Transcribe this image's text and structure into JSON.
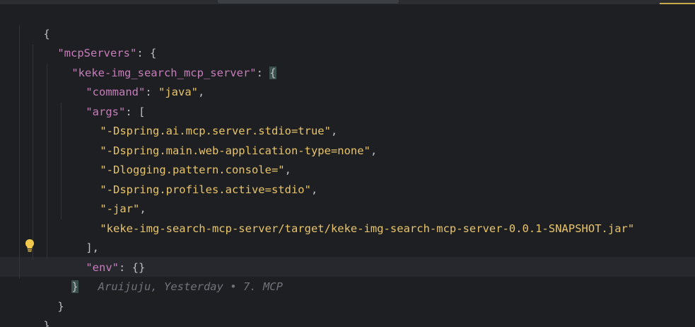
{
  "editor": {
    "language": "json",
    "lines": [
      {
        "id": "l1",
        "tokens": [
          "{"
        ]
      },
      {
        "id": "l2",
        "tokens": [
          "\"mcpServers\"",
          ": {"
        ]
      },
      {
        "id": "l3",
        "tokens": [
          "\"keke-img_search_mcp_server\"",
          ": ",
          "{"
        ]
      },
      {
        "id": "l4",
        "tokens": [
          "\"command\"",
          ": ",
          "\"java\"",
          ","
        ]
      },
      {
        "id": "l5",
        "tokens": [
          "\"args\"",
          ": ["
        ]
      },
      {
        "id": "l6",
        "tokens": [
          "\"-Dspring.ai.mcp.server.stdio=true\"",
          ","
        ]
      },
      {
        "id": "l7",
        "tokens": [
          "\"-Dspring.main.web-application-type=none\"",
          ","
        ]
      },
      {
        "id": "l8",
        "tokens": [
          "\"-Dlogging.pattern.console=\"",
          ","
        ]
      },
      {
        "id": "l9",
        "tokens": [
          "\"-Dspring.profiles.active=stdio\"",
          ","
        ]
      },
      {
        "id": "l10",
        "tokens": [
          "\"-jar\"",
          ","
        ]
      },
      {
        "id": "l11",
        "tokens": [
          "\"keke-img-search-mcp-server/target/keke-img-search-mcp-server-0.0.1-SNAPSHOT.jar\""
        ]
      },
      {
        "id": "l12",
        "tokens": [
          "],"
        ]
      },
      {
        "id": "l13",
        "tokens": [
          "\"env\"",
          ": {}"
        ]
      },
      {
        "id": "l14",
        "tokens": [
          "}"
        ]
      },
      {
        "id": "l15",
        "tokens": [
          "}"
        ]
      },
      {
        "id": "l16",
        "tokens": [
          "}"
        ]
      }
    ],
    "blame_annotation": "Aruijuju, Yesterday • 7. MCP",
    "icons": {
      "intention_bulb": "lightbulb-icon"
    },
    "colors": {
      "background": "#1e1f22",
      "key": "#c77dbb",
      "string": "#e8c46a",
      "annotation": "#6f737a",
      "current_line": "#26282e"
    }
  }
}
